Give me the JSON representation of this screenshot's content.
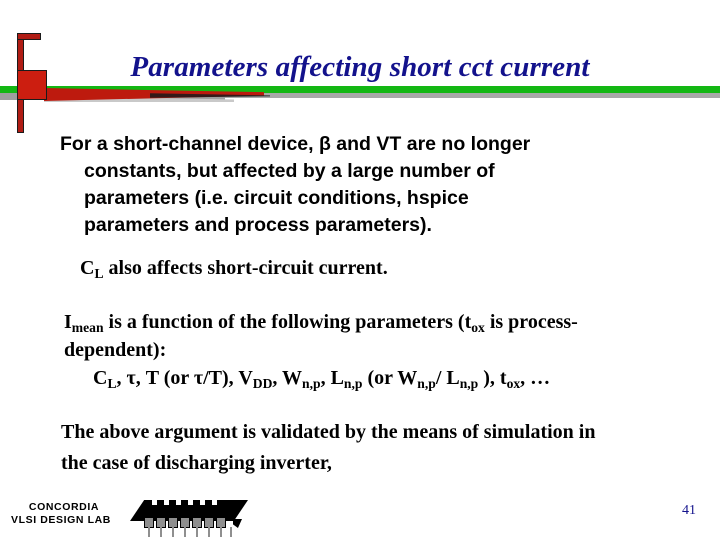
{
  "slide": {
    "title": "Parameters affecting short cct current",
    "title_color": "#13128C",
    "page_number": "41"
  },
  "decoration": {
    "bar_red": "#BD1A0E",
    "bar_green": "#13B713",
    "square_red": "#CC1E10",
    "shadow_gray": "#a8a8a8"
  },
  "body": {
    "paragraph_1": {
      "line_1": "For a short-channel device, β and VT are no longer",
      "line_2": "constants, but affected by a large number of",
      "line_3": "parameters (i.e. circuit conditions, hspice",
      "line_4": "parameters and process parameters)."
    },
    "paragraph_2": {
      "symbol": "C",
      "symbol_sub": "L",
      "text": " also affects short-circuit current."
    },
    "paragraph_3": {
      "symbol": "I",
      "symbol_sub": "mean",
      "text_a": " is a function of the following parameters (t",
      "text_a_sub": "ox",
      "text_b": " is process-",
      "line_2": "dependent):"
    },
    "paragraph_4": {
      "s1": "C",
      "s1_sub": "L",
      "s2": ", τ, T (or τ/T), V",
      "s2_sub": "DD",
      "s3": ", W",
      "s3_sub": "n,p",
      "s4": ", L",
      "s4_sub": "n,p",
      "s5": " (or W",
      "s5_sub": "n,p",
      "s6": "/ L",
      "s6_sub": "n,p",
      "s7": " ), t",
      "s7_sub": "ox",
      "s8": ", …"
    },
    "paragraph_5": {
      "line_1": "The above argument is validated by the means of simulation in",
      "line_2": "the case of discharging inverter,"
    }
  },
  "footer": {
    "logo_line_1": "CONCORDIA",
    "logo_line_2": "VLSI DESIGN LAB"
  }
}
